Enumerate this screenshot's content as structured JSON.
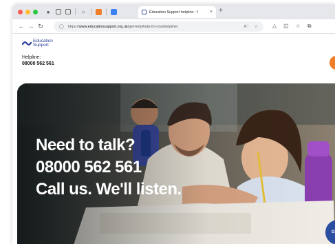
{
  "browser": {
    "tab_title": "Education Support helpline - f",
    "tab_close": "×",
    "new_tab": "+",
    "url_prefix": "https://",
    "url_domain": "www.educationsupport.org.uk",
    "url_path": "/get-help/help-for-you/helpline/"
  },
  "site": {
    "logo_line1": "Education",
    "logo_line2": "Support",
    "helpline_label": "Helpline:",
    "helpline_number": "08000 562 561"
  },
  "hero": {
    "line1": "Need to talk?",
    "line2": "08000 562 561",
    "line3": "Call us. We'll listen.",
    "cta_label": "Ge"
  }
}
